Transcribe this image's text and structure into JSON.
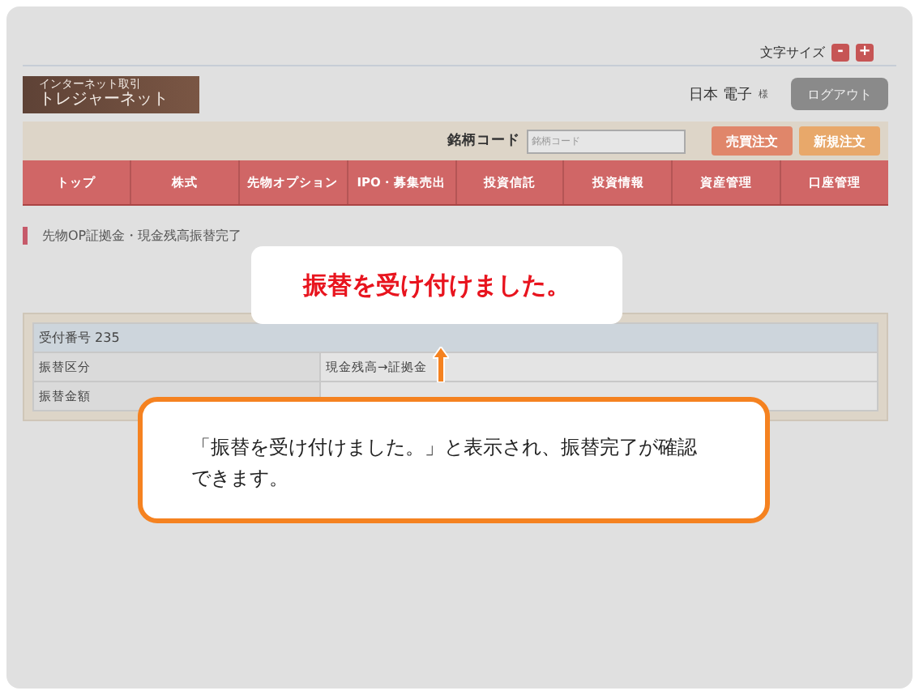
{
  "font_size": {
    "label": "文字サイズ",
    "buttons": [
      "-",
      "+"
    ]
  },
  "logo": {
    "caption": "インターネット取引",
    "name": "トレジャーネット"
  },
  "user": {
    "name": "日本 電子",
    "honorific": "様"
  },
  "logout": "ログアウト",
  "search": {
    "label": "銘柄コード",
    "placeholder": "銘柄コード"
  },
  "order_buttons": [
    {
      "label": "売買注文",
      "color": "#e0866a"
    },
    {
      "label": "新規注文",
      "color": "#e8a86a"
    }
  ],
  "nav": [
    "トップ",
    "株式",
    "先物オプション",
    "IPO・募集売出",
    "投資信託",
    "投資情報",
    "資産管理",
    "口座管理"
  ],
  "page_title": "先物OP証拠金・現金残高振替完了",
  "table": {
    "header": "受付番号 235",
    "rows": [
      {
        "label": "振替区分",
        "value": "現金残高→証拠金"
      },
      {
        "label": "振替金額"
      }
    ]
  },
  "callout_top": "振替を受け付けました。",
  "callout_bottom": "「振替を受け付けました。」と表示され、振替完了が確認できます。"
}
